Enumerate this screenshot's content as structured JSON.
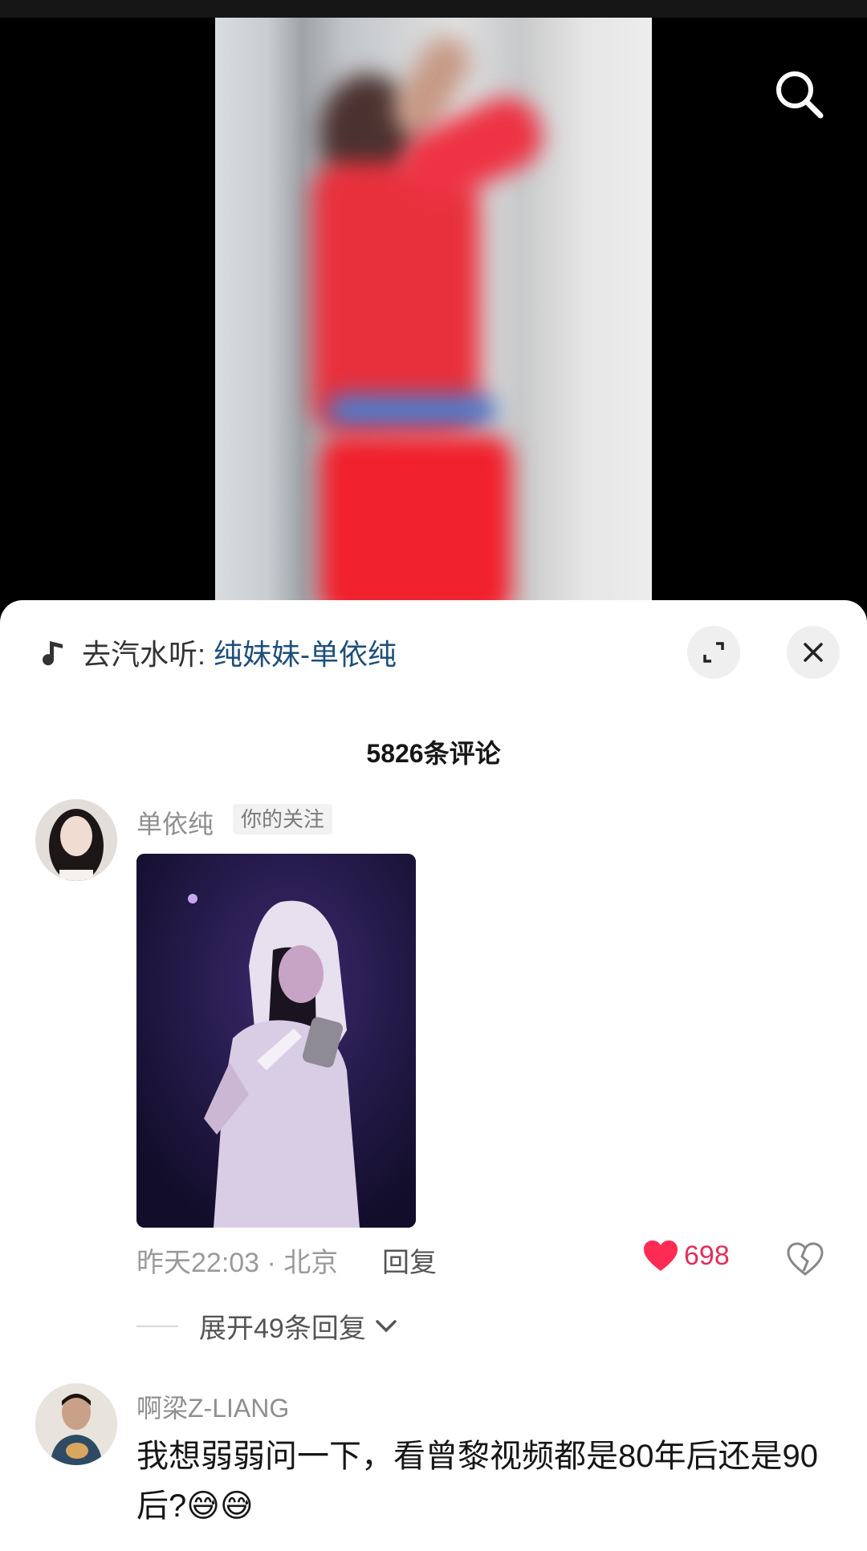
{
  "music": {
    "prefix": "去汽水听:",
    "link": "纯妹妹-单依纯"
  },
  "comments_header": {
    "count_label": "5826条评论"
  },
  "comments": [
    {
      "username": "单依纯",
      "tag": "你的关注",
      "time_location": "昨天22:03 · 北京",
      "reply_label": "回复",
      "likes": "698",
      "expand_label": "展开49条回复"
    },
    {
      "username": "啊梁Z-LIANG",
      "text": "我想弱弱问一下，看曾黎视频都是80年后还是90后?😅😅"
    }
  ],
  "icons": {
    "search": "search-icon",
    "music": "music-note-icon",
    "expand": "collapse-arrow-icon",
    "close": "close-icon",
    "like": "heart-icon",
    "dislike": "broken-heart-icon",
    "chevron": "chevron-down-icon"
  },
  "colors": {
    "like": "#fe2c55",
    "link": "#1e4f7a",
    "panel_bg": "#ffffff"
  }
}
